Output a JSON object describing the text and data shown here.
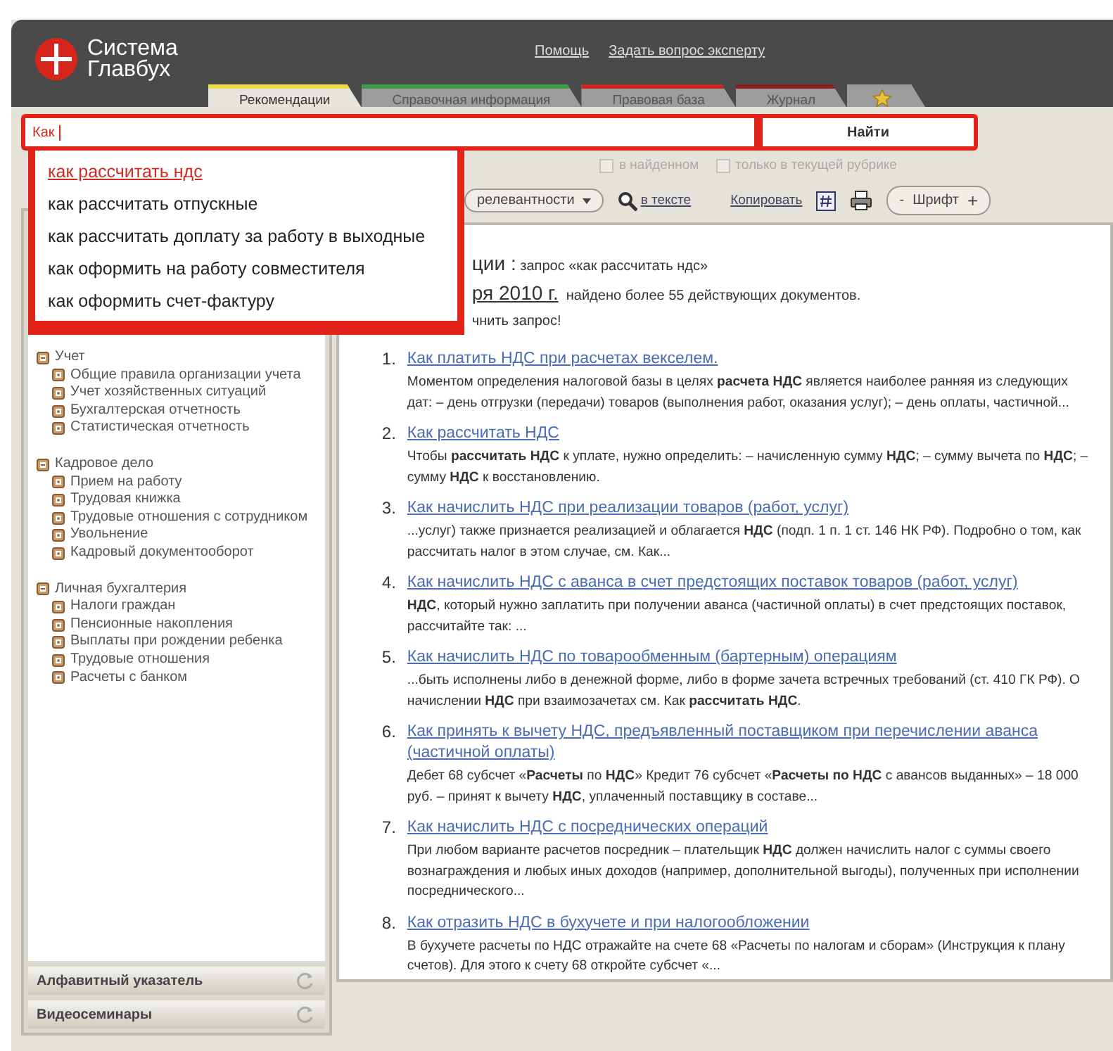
{
  "header": {
    "logo_lines": [
      "Система",
      "Главбух"
    ],
    "links": [
      "Помощь",
      "Задать вопрос эксперту"
    ]
  },
  "tabs": [
    {
      "kind": "text",
      "label": "Рекомендации",
      "selected": true,
      "color": "#e8df4a"
    },
    {
      "kind": "text",
      "label": "Справочная информация",
      "selected": false,
      "color": "#3f9a4a"
    },
    {
      "kind": "text",
      "label": "Правовая база",
      "selected": false,
      "color": "#c8261f"
    },
    {
      "kind": "text",
      "label": "Журнал",
      "selected": false,
      "color": "#8a1f1f"
    },
    {
      "kind": "favorites",
      "selected": false,
      "color": "#9a9a9a"
    }
  ],
  "search": {
    "value": "Как",
    "button": "Найти"
  },
  "suggestions": [
    {
      "text": "как рассчитать ндс",
      "selected": true
    },
    {
      "text": "как рассчитать отпускные",
      "selected": false
    },
    {
      "text": "как рассчитать доплату за работу в выходные",
      "selected": false
    },
    {
      "text": "как оформить на работу совместителя",
      "selected": false
    },
    {
      "text": "как оформить счет-фактуру",
      "selected": false
    }
  ],
  "filters": [
    {
      "label": "в найденном",
      "checked": false,
      "disabled": true
    },
    {
      "label": "только в текущей рубрике",
      "checked": false,
      "disabled": true
    }
  ],
  "toolbar": {
    "sort": "релевантности",
    "search_in_text": "в тексте",
    "copy": "Копировать",
    "font_minus": "-",
    "font": "Шрифт",
    "font_plus": "+"
  },
  "sidebar": {
    "tree": [
      {
        "label": "Учет",
        "expanded": true,
        "children": [
          {
            "label": "Общие правила организации учета",
            "expanded": false
          },
          {
            "label": "Учет хозяйственных ситуаций",
            "expanded": false
          },
          {
            "label": "Бухгалтерская отчетность",
            "expanded": false
          },
          {
            "label": "Статистическая отчетность",
            "expanded": false
          }
        ]
      },
      {
        "label": "Кадровое дело",
        "expanded": true,
        "children": [
          {
            "label": "Прием на работу",
            "expanded": false
          },
          {
            "label": "Трудовая книжка",
            "expanded": false
          },
          {
            "label": "Трудовые отношения с сотрудником",
            "expanded": false
          },
          {
            "label": "Увольнение",
            "expanded": false
          },
          {
            "label": "Кадровый документооборот",
            "expanded": false
          }
        ]
      },
      {
        "label": "Личная бухгалтерия",
        "expanded": true,
        "children": [
          {
            "label": "Налоги граждан",
            "expanded": false
          },
          {
            "label": "Пенсионные накопления",
            "expanded": false
          },
          {
            "label": "Выплаты при рождении ребенка",
            "expanded": false
          },
          {
            "label": "Трудовые отношения",
            "expanded": false
          },
          {
            "label": "Расчеты с банком",
            "expanded": false
          }
        ]
      }
    ],
    "panels": [
      "Алфавитный указатель",
      "Видеосеминары"
    ]
  },
  "results": {
    "heading": "ции :",
    "query": "запрос «как рассчитать ндс»",
    "date": "ря 2010 г.",
    "found": "найдено более 55 действующих документов.",
    "hint": "чнить запрос!",
    "items": [
      {
        "number": "1.",
        "title": "Как платить НДС при расчетах векселем.",
        "snippet": "Моментом определения налоговой базы в целях **расчета НДС** является наиболее ранняя из следующих дат: – день отгрузки (передачи) товаров (выполнения работ, оказания услуг); – день оплаты, частичной..."
      },
      {
        "number": "2.",
        "title": "Как рассчитать НДС",
        "snippet": "Чтобы **рассчитать НДС** к уплате, нужно определить: – начисленную сумму **НДС**; – сумму вычета по **НДС**; – сумму **НДС** к восстановлению."
      },
      {
        "number": "3.",
        "title": "Как начислить НДС при реализации товаров (работ, услуг)",
        "snippet": "...услуг) также признается реализацией и облагается **НДС** (подп. 1 п. 1 ст. 146 НК РФ). Подробно о том, как рассчитать налог в этом случае, см. Как..."
      },
      {
        "number": "4.",
        "title": "Как начислить НДС с аванса в счет предстоящих поставок товаров (работ, услуг)",
        "snippet": "**НДС**, который нужно заплатить при получении аванса (частичной оплаты) в счет предстоящих поставок, рассчитайте так: ..."
      },
      {
        "number": "5.",
        "title": "Как начислить НДС по товарообменным (бартерным) операциям",
        "snippet": "...быть исполнены либо в денежной форме, либо в форме зачета встречных требований (ст. 410 ГК РФ). О начислении **НДС** при взаимозачетах см. Как **рассчитать НДС**."
      },
      {
        "number": "6.",
        "title": "Как принять к вычету НДС, предъявленный поставщиком при перечислении аванса (частичной оплаты)",
        "snippet": "Дебет 68 субсчет «**Расчеты** по **НДС**» Кредит 76 субсчет «**Расчеты по НДС** с авансов выданных» – 18 000 руб. – принят к вычету **НДС**, уплаченный поставщику в составе..."
      },
      {
        "number": "7.",
        "title": "Как начислить НДС с посреднических операций",
        "snippet": "При любом варианте расчетов посредник – плательщик **НДС** должен начислить налог с суммы своего вознаграждения и любых иных доходов (например, дополнительной выгоды), полученных при исполнении посреднического..."
      },
      {
        "number": "8.",
        "title": "Как отразить НДС в бухучете и при налогообложении",
        "snippet": "В бухучете расчеты по НДС отражайте на счете 68 «Расчеты по налогам и сборам» (Инструкция к плану счетов). Для этого к счету 68 откройте субсчет «..."
      }
    ]
  }
}
